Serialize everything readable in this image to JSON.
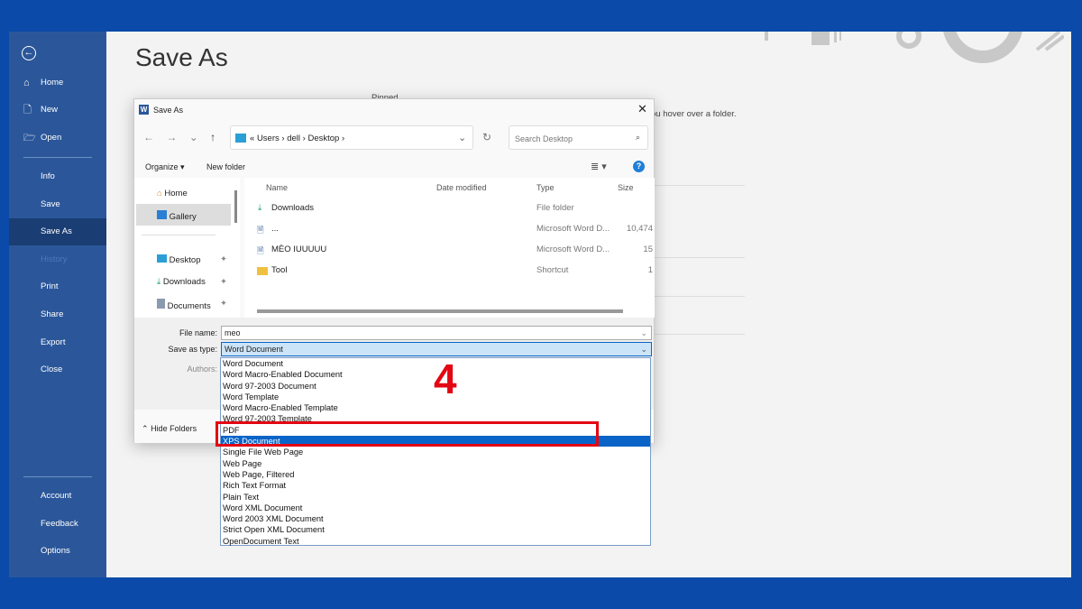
{
  "sidebar": {
    "items": [
      {
        "label": "Home",
        "icon": "home-icon"
      },
      {
        "label": "New",
        "icon": "new-file-icon"
      },
      {
        "label": "Open",
        "icon": "folder-open-icon"
      },
      {
        "label": "Info"
      },
      {
        "label": "Save"
      },
      {
        "label": "Save As",
        "selected": true
      },
      {
        "label": "History",
        "disabled": true
      },
      {
        "label": "Print"
      },
      {
        "label": "Share"
      },
      {
        "label": "Export"
      },
      {
        "label": "Close"
      }
    ],
    "bottom": [
      {
        "label": "Account"
      },
      {
        "label": "Feedback"
      },
      {
        "label": "Options"
      }
    ]
  },
  "page": {
    "title": "Save As",
    "pinned": "Pinned",
    "hint": "ou hover over a folder."
  },
  "dialog": {
    "title": "Save As",
    "breadcrumb": [
      "«",
      "Users",
      "dell",
      "Desktop"
    ],
    "search_placeholder": "Search Desktop",
    "organize": "Organize ▾",
    "new_folder": "New folder",
    "nav": [
      {
        "label": "Home",
        "icon": "home-icon"
      },
      {
        "label": "Gallery",
        "icon": "gallery-icon",
        "selected": true
      },
      {
        "label": "Desktop",
        "icon": "desktop-icon",
        "pinned": true
      },
      {
        "label": "Downloads",
        "icon": "download-icon",
        "pinned": true
      },
      {
        "label": "Documents",
        "icon": "documents-icon",
        "pinned": true
      }
    ],
    "columns": [
      "Name",
      "Date modified",
      "Type",
      "Size"
    ],
    "files": [
      {
        "name": "Downloads",
        "type": "File folder",
        "size": "",
        "icon": "download-icon"
      },
      {
        "name": "...",
        "type": "Microsoft Word D...",
        "size": "10,474",
        "icon": "word-file-icon"
      },
      {
        "name": "MÈO IUUUUU",
        "type": "Microsoft Word D...",
        "size": "15",
        "icon": "word-file-icon"
      },
      {
        "name": "Tool",
        "type": "Shortcut",
        "size": "1",
        "icon": "shortcut-folder-icon"
      }
    ],
    "file_name_label": "File name:",
    "file_name": "meo",
    "save_type_label": "Save as type:",
    "save_type": "Word Document",
    "authors_label": "Authors:",
    "hide_folders": "Hide Folders",
    "type_options": [
      "Word Document",
      "Word Macro-Enabled Document",
      "Word 97-2003 Document",
      "Word Template",
      "Word Macro-Enabled Template",
      "Word 97-2003 Template",
      "PDF",
      "XPS Document",
      "Single File Web Page",
      "Web Page",
      "Web Page, Filtered",
      "Rich Text Format",
      "Plain Text",
      "Word XML Document",
      "Word 2003 XML Document",
      "Strict Open XML Document",
      "OpenDocument Text"
    ],
    "highlighted_option": "XPS Document"
  },
  "annotation": {
    "step": "4",
    "color": "#e30613"
  }
}
